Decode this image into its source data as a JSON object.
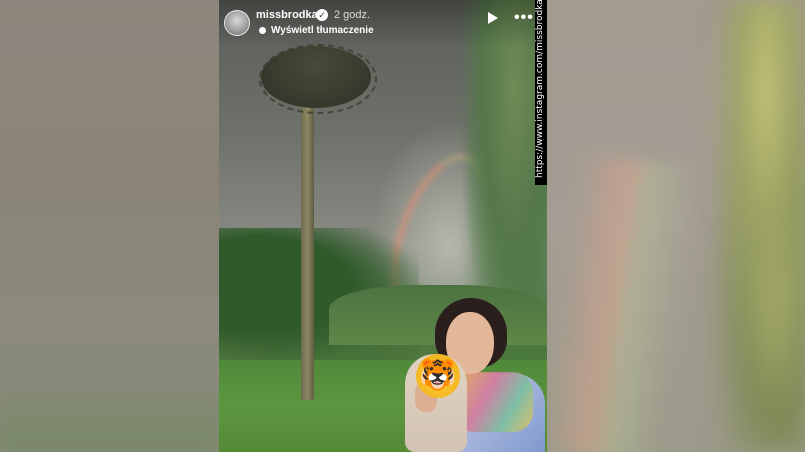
{
  "story": {
    "username": "missbrodka",
    "time": "2 godz.",
    "translate_label": "Wyświetl tłumaczenie",
    "verified_icon": "check-badge-icon",
    "play_icon": "play-icon",
    "more_icon": "more-dots-icon"
  },
  "watermark": {
    "url": "https://www.instagram.com/missbrodka/?..."
  },
  "sticker": {
    "emoji": "🐯"
  }
}
